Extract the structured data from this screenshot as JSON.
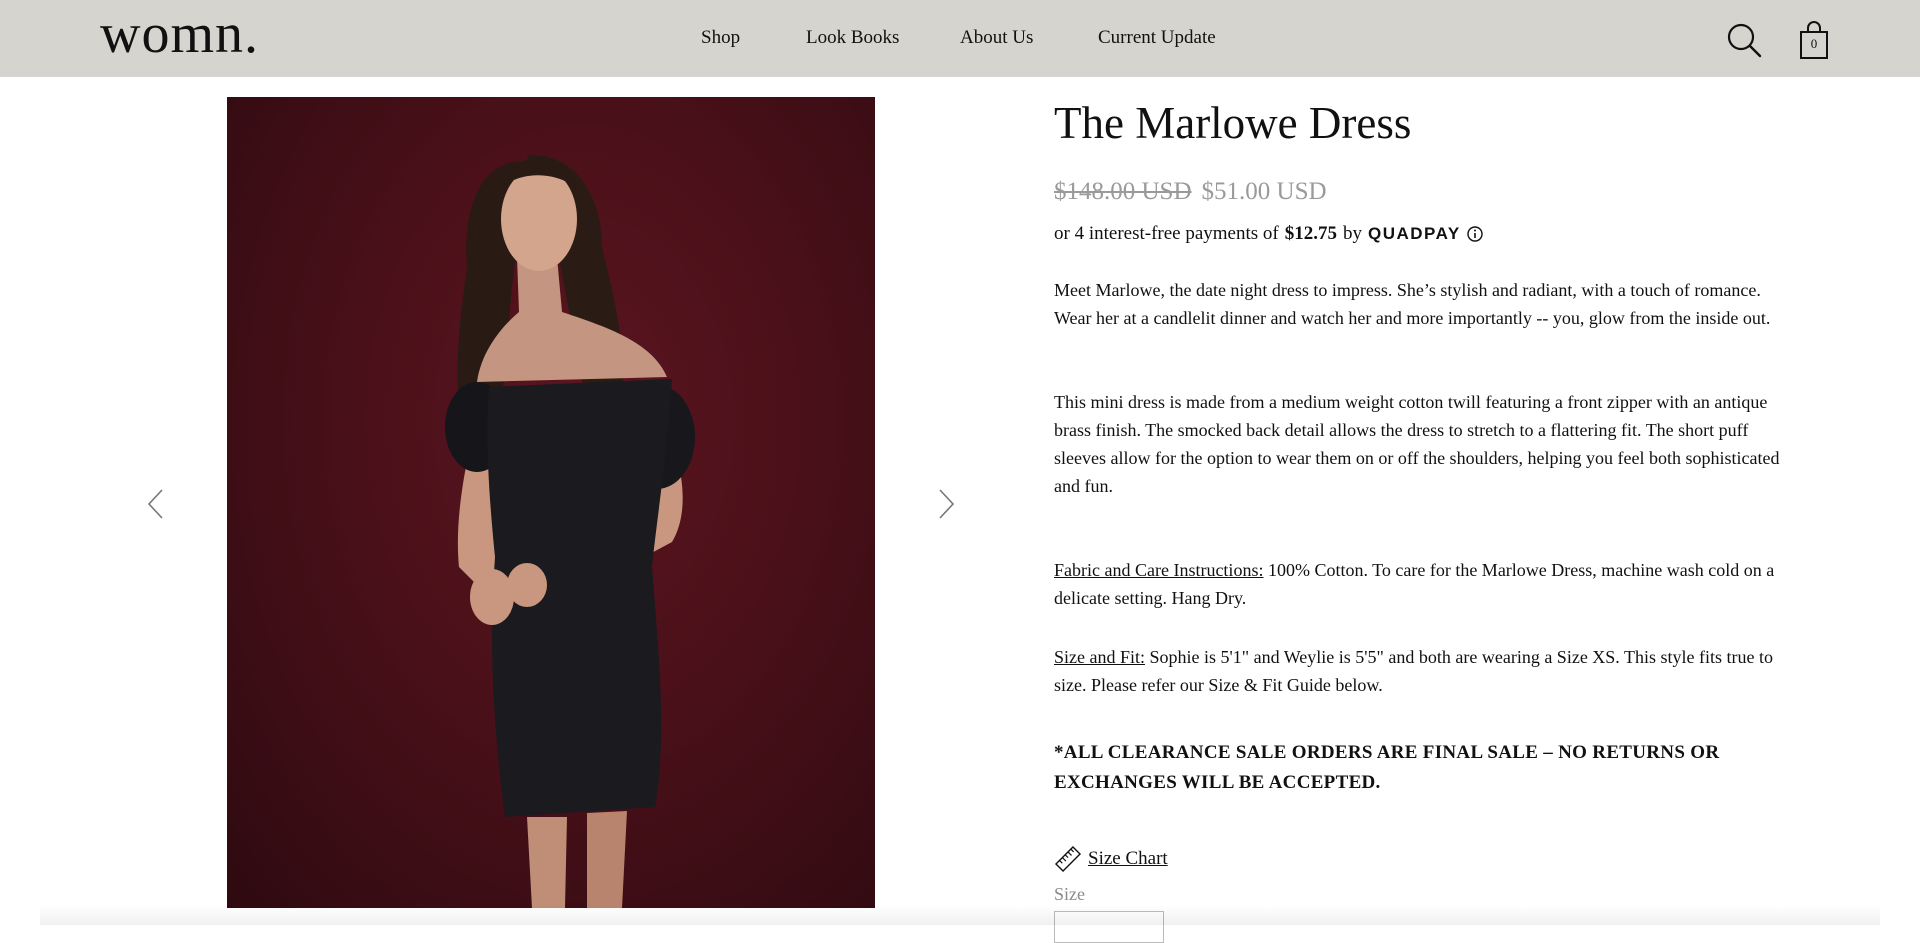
{
  "header": {
    "logo": "womn.",
    "nav": [
      "Shop",
      "Look Books",
      "About Us",
      "Current Update"
    ],
    "cart_count": "0"
  },
  "product": {
    "title": "The Marlowe Dress",
    "price_original": "$148.00 USD",
    "price_sale": "$51.00 USD",
    "installments": {
      "prefix": "or 4 interest-free payments of",
      "amount": "$12.75",
      "by": "by",
      "provider": "QUADPAY"
    },
    "description": [
      "Meet Marlowe, the date night dress to impress. She’s stylish and radiant, with a touch of romance. Wear her at a candlelit dinner and watch her and more importantly -- you, glow from the inside out.",
      "This mini dress is made from a medium weight cotton twill featuring a front zipper with an antique brass finish. The smocked back detail allows the dress to stretch to a flattering fit. The short puff sleeves allow for the option to wear them on or off the shoulders, helping you feel both sophisticated and fun."
    ],
    "care": {
      "label": "Fabric and Care Instructions:",
      "text": " 100% Cotton. To care for the Marlowe Dress, machine wash cold on a delicate setting. Hang Dry."
    },
    "fit": {
      "label": "Size and Fit:",
      "text": " Sophie is 5'1\" and Weylie is 5'5\" and both are wearing a Size XS. This style fits true to size. Please refer our Size & Fit Guide below."
    },
    "notice": "*ALL CLEARANCE SALE ORDERS ARE FINAL SALE – NO RETURNS OR EXCHANGES WILL BE ACCEPTED.",
    "size_chart_label": "Size Chart",
    "size_label": "Size"
  },
  "colors": {
    "header_bg": "#d6d4cf",
    "photo_bg": "#4a1019",
    "sale_price": "#9a9a9a"
  }
}
